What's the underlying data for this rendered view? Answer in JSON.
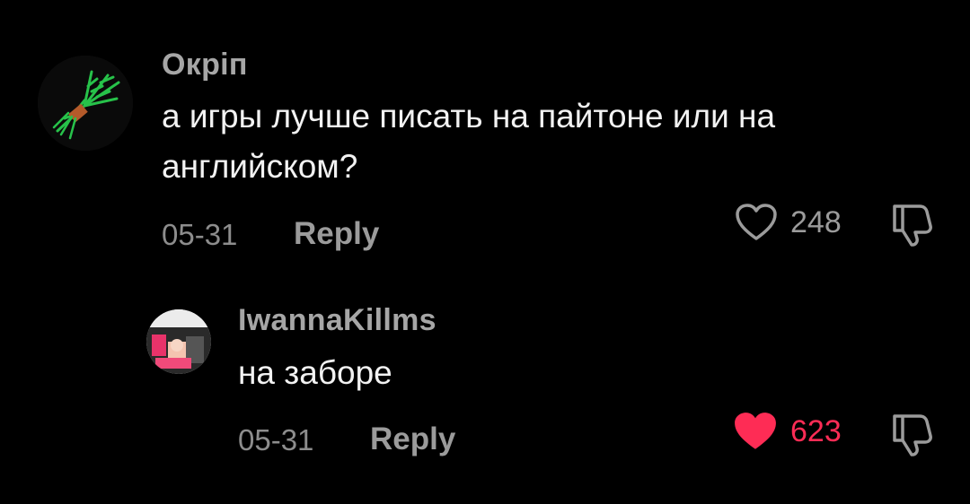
{
  "colors": {
    "background": "#000000",
    "username": "#a6a6a6",
    "text": "#f2f2f2",
    "meta": "#8d8d8d",
    "liked": "#fe2c55",
    "icon": "#9b9b9b"
  },
  "comments": [
    {
      "username": "Окріп",
      "avatar_icon": "dill-bunch-avatar",
      "text": "а игры лучше писать на пайтоне или на английском?",
      "date": "05-31",
      "reply_label": "Reply",
      "like_count": "248",
      "liked": false,
      "like_icon": "heart-outline-icon",
      "dislike_icon": "thumbs-down-icon"
    },
    {
      "username": "IwannaKillms",
      "avatar_icon": "photo-avatar",
      "text": "на заборе",
      "date": "05-31",
      "reply_label": "Reply",
      "like_count": "623",
      "liked": true,
      "like_icon": "heart-filled-icon",
      "dislike_icon": "thumbs-down-icon"
    }
  ]
}
